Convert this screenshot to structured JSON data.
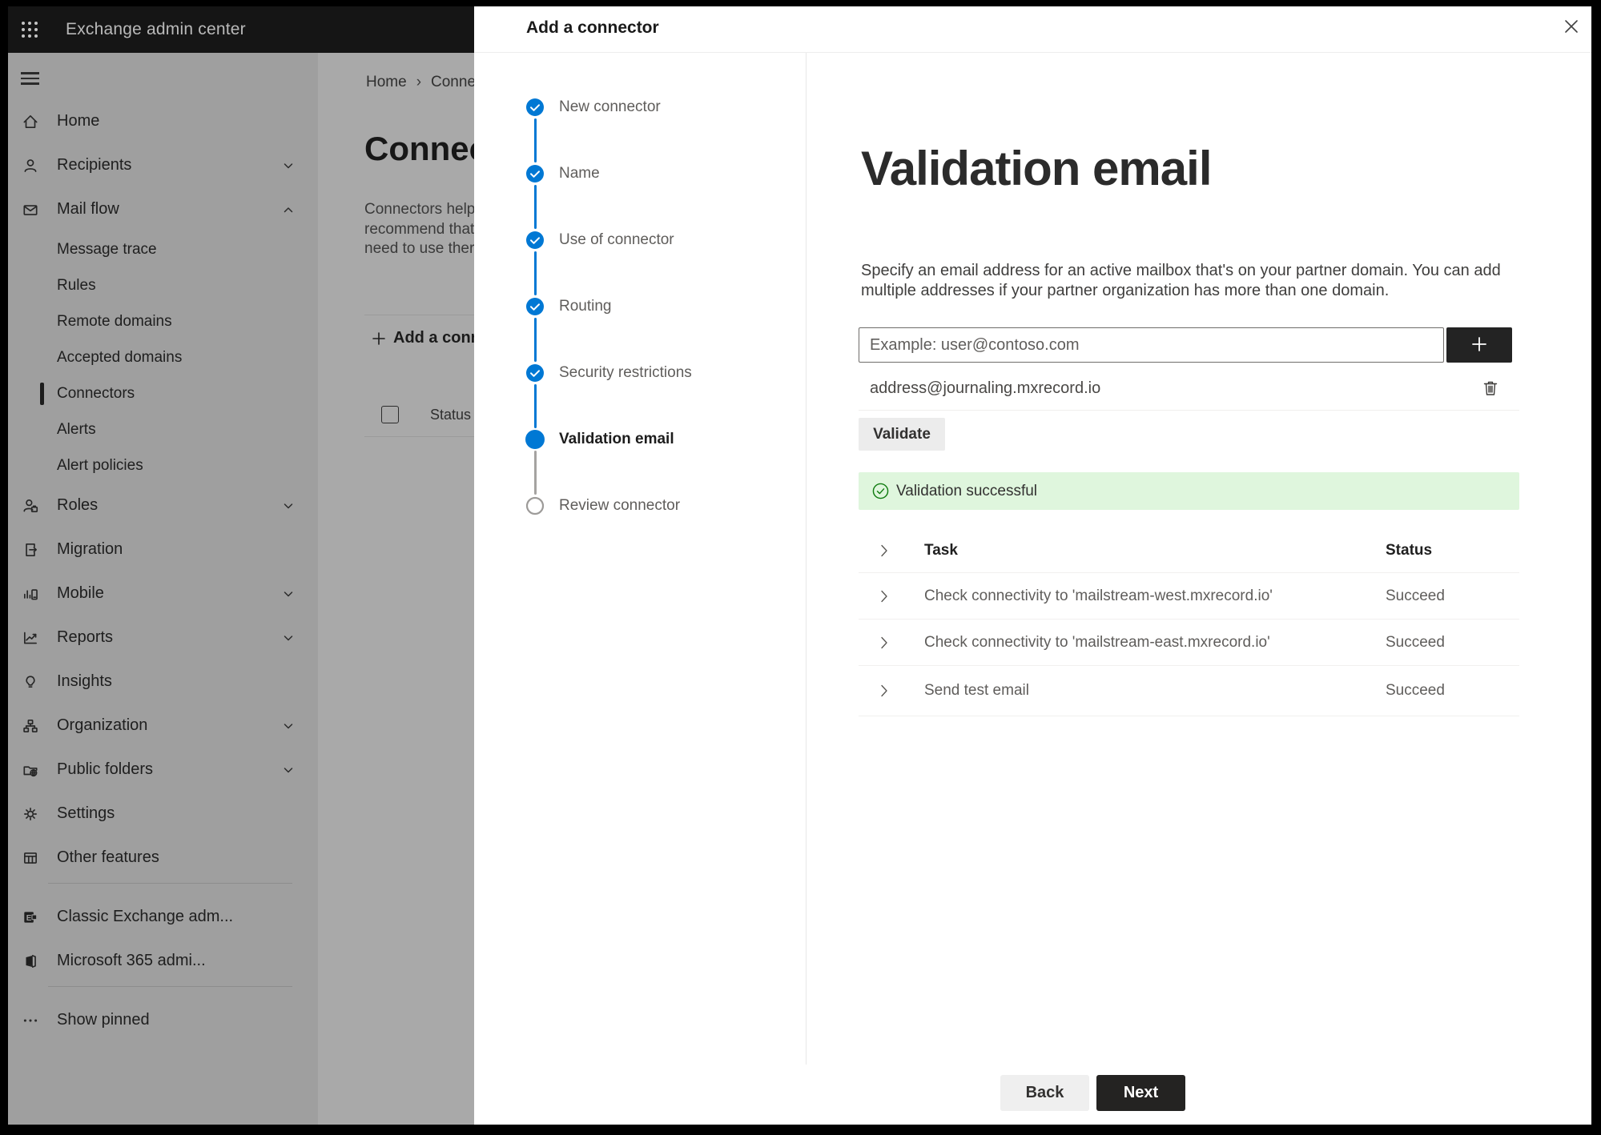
{
  "topbar": {
    "title": "Exchange admin center",
    "waffle_icon": "app-launcher-icon"
  },
  "breadcrumb": {
    "home": "Home",
    "current": "Conne"
  },
  "background_page": {
    "heading": "Connect",
    "paragraph_lines": [
      "Connectors help",
      "recommend that",
      "need to use ther"
    ],
    "add_button_label": "Add a conn",
    "column_header": "Status"
  },
  "sidebar": {
    "items": [
      {
        "label": "Home",
        "icon": "home-icon",
        "type": "top",
        "chevron": null,
        "selected": false
      },
      {
        "label": "Recipients",
        "icon": "person-icon",
        "type": "top",
        "chevron": "down",
        "selected": false
      },
      {
        "label": "Mail flow",
        "icon": "mail-icon",
        "type": "top",
        "chevron": "up",
        "selected": false
      },
      {
        "label": "Message trace",
        "icon": null,
        "type": "sub",
        "chevron": null,
        "selected": false
      },
      {
        "label": "Rules",
        "icon": null,
        "type": "sub",
        "chevron": null,
        "selected": false
      },
      {
        "label": "Remote domains",
        "icon": null,
        "type": "sub",
        "chevron": null,
        "selected": false
      },
      {
        "label": "Accepted domains",
        "icon": null,
        "type": "sub",
        "chevron": null,
        "selected": false
      },
      {
        "label": "Connectors",
        "icon": null,
        "type": "sub",
        "chevron": null,
        "selected": true
      },
      {
        "label": "Alerts",
        "icon": null,
        "type": "sub",
        "chevron": null,
        "selected": false
      },
      {
        "label": "Alert policies",
        "icon": null,
        "type": "sub",
        "chevron": null,
        "selected": false
      },
      {
        "label": "Roles",
        "icon": "roles-icon",
        "type": "top",
        "chevron": "down",
        "selected": false
      },
      {
        "label": "Migration",
        "icon": "migration-icon",
        "type": "top",
        "chevron": null,
        "selected": false
      },
      {
        "label": "Mobile",
        "icon": "mobile-icon",
        "type": "top",
        "chevron": "down",
        "selected": false
      },
      {
        "label": "Reports",
        "icon": "reports-icon",
        "type": "top",
        "chevron": "down",
        "selected": false
      },
      {
        "label": "Insights",
        "icon": "insights-icon",
        "type": "top",
        "chevron": null,
        "selected": false
      },
      {
        "label": "Organization",
        "icon": "organization-icon",
        "type": "top",
        "chevron": "down",
        "selected": false
      },
      {
        "label": "Public folders",
        "icon": "public-folders-icon",
        "type": "top",
        "chevron": "down",
        "selected": false
      },
      {
        "label": "Settings",
        "icon": "settings-icon",
        "type": "top",
        "chevron": null,
        "selected": false
      },
      {
        "label": "Other features",
        "icon": "other-features-icon",
        "type": "top",
        "chevron": null,
        "selected": false
      },
      {
        "label": "divider",
        "icon": null,
        "type": "divider",
        "chevron": null,
        "selected": false
      },
      {
        "label": "Classic Exchange adm...",
        "icon": "classic-exchange-icon",
        "type": "top",
        "chevron": null,
        "selected": false
      },
      {
        "label": "Microsoft 365 admi...",
        "icon": "m365-icon",
        "type": "top",
        "chevron": null,
        "selected": false
      },
      {
        "label": "divider",
        "icon": null,
        "type": "divider",
        "chevron": null,
        "selected": false
      },
      {
        "label": "Show pinned",
        "icon": "more-icon",
        "type": "top",
        "chevron": null,
        "selected": false
      }
    ]
  },
  "wizard": {
    "title": "Add a connector",
    "close_icon": "close-icon",
    "steps": [
      {
        "label": "New connector",
        "state": "complete"
      },
      {
        "label": "Name",
        "state": "complete"
      },
      {
        "label": "Use of connector",
        "state": "complete"
      },
      {
        "label": "Routing",
        "state": "complete"
      },
      {
        "label": "Security restrictions",
        "state": "complete"
      },
      {
        "label": "Validation email",
        "state": "current"
      },
      {
        "label": "Review connector",
        "state": "upcoming"
      }
    ]
  },
  "main": {
    "heading": "Validation email",
    "description_line1": "Specify an email address for an active mailbox that's on your partner domain. You can add",
    "description_line2": "multiple addresses if your partner organization has more than one domain.",
    "email_input": {
      "value": "",
      "placeholder": "Example: user@contoso.com"
    },
    "add_address_icon": "plus-icon",
    "addresses": [
      {
        "email": "address@journaling.mxrecord.io",
        "action_icon": "trash-icon"
      }
    ],
    "validate_button": "Validate",
    "banner": {
      "icon": "success-check-icon",
      "text": "Validation successful"
    },
    "tasks_table": {
      "columns": [
        "Task",
        "Status"
      ],
      "rows": [
        {
          "task": "Check connectivity to 'mailstream-west.mxrecord.io'",
          "status": "Succeed"
        },
        {
          "task": "Check connectivity to 'mailstream-east.mxrecord.io'",
          "status": "Succeed"
        },
        {
          "task": "Send test email",
          "status": "Succeed"
        }
      ]
    },
    "footer": {
      "back": "Back",
      "next": "Next"
    }
  },
  "colors": {
    "accent_blue": "#0078d4",
    "success_green": "#107c10",
    "success_banner_bg": "#dff6dd"
  }
}
